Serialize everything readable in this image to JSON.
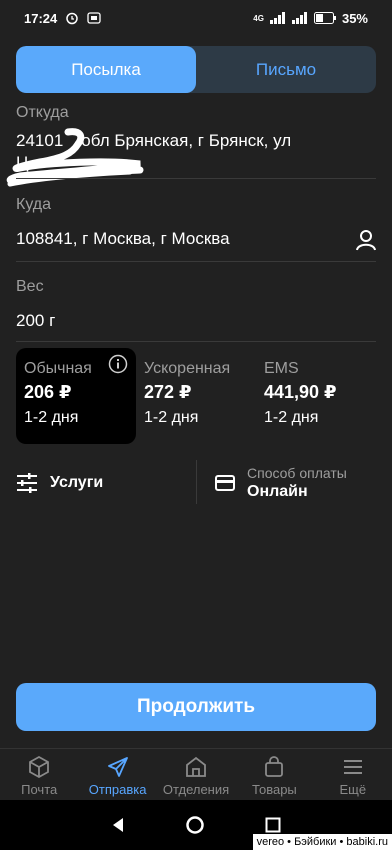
{
  "status_bar": {
    "time": "17:24",
    "battery": "35%",
    "network": "4G"
  },
  "segment": {
    "parcel": "Посылка",
    "letter": "Письмо"
  },
  "from": {
    "label": "Откуда",
    "value_line1": "24101",
    "value_line1_rest": "обл Брянская, г Брянск, ул",
    "value_line2": "Ц"
  },
  "to": {
    "label": "Куда",
    "value": "108841, г Москва, г Москва"
  },
  "weight": {
    "label": "Вес",
    "value": "200 г"
  },
  "tariffs": [
    {
      "name": "Обычная",
      "price": "206 ₽",
      "term": "1-2 дня"
    },
    {
      "name": "Ускоренная",
      "price": "272 ₽",
      "term": "1-2 дня"
    },
    {
      "name": "EMS",
      "price": "441,90 ₽",
      "term": "1-2 дня"
    }
  ],
  "options": {
    "services": "Услуги",
    "payment_caption": "Способ оплаты",
    "payment_value": "Онлайн"
  },
  "continue_label": "Продолжить",
  "tabs": [
    {
      "label": "Почта",
      "icon": "box-icon"
    },
    {
      "label": "Отправка",
      "icon": "send-icon"
    },
    {
      "label": "Отделения",
      "icon": "building-icon"
    },
    {
      "label": "Товары",
      "icon": "bag-icon"
    },
    {
      "label": "Ещё",
      "icon": "menu-icon"
    }
  ],
  "watermark": "vereo • Бэйбики • babiki.ru",
  "colors": {
    "accent": "#5aa9fb",
    "background": "#212121",
    "accent_text": "#58a6ff"
  }
}
